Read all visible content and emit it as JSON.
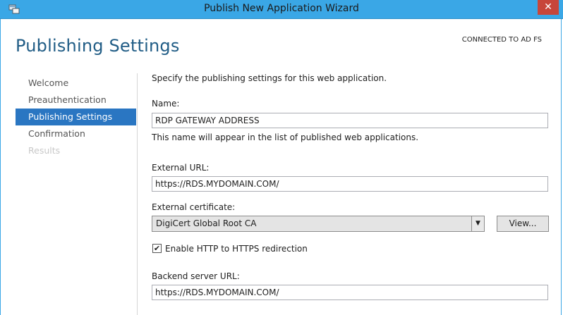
{
  "window": {
    "title": "Publish New Application Wizard",
    "close_glyph": "✕"
  },
  "page": {
    "title": "Publishing Settings",
    "status": "CONNECTED TO AD FS"
  },
  "nav": {
    "items": [
      {
        "label": "Welcome"
      },
      {
        "label": "Preauthentication"
      },
      {
        "label": "Publishing Settings"
      },
      {
        "label": "Confirmation"
      },
      {
        "label": "Results"
      }
    ]
  },
  "form": {
    "intro": "Specify the publishing settings for this web application.",
    "name_label": "Name:",
    "name_value": "RDP GATEWAY ADDRESS",
    "name_hint": "This name will appear in the list of published web applications.",
    "external_url_label": "External URL:",
    "external_url_value": "https://RDS.MYDOMAIN.COM/",
    "certificate_label": "External certificate:",
    "certificate_value": "DigiCert Global Root CA",
    "view_button": "View...",
    "redirect_label": "Enable HTTP to HTTPS redirection",
    "redirect_checked": "✔",
    "backend_label": "Backend server URL:",
    "backend_value": "https://RDS.MYDOMAIN.COM/"
  },
  "icons": {
    "window": "wizard-app-icon",
    "dropdown": "chevron-down-icon"
  },
  "colors": {
    "titlebar": "#3aa7e6",
    "accent": "#2a76c2",
    "close": "#c7463a",
    "heading": "#215d86"
  }
}
